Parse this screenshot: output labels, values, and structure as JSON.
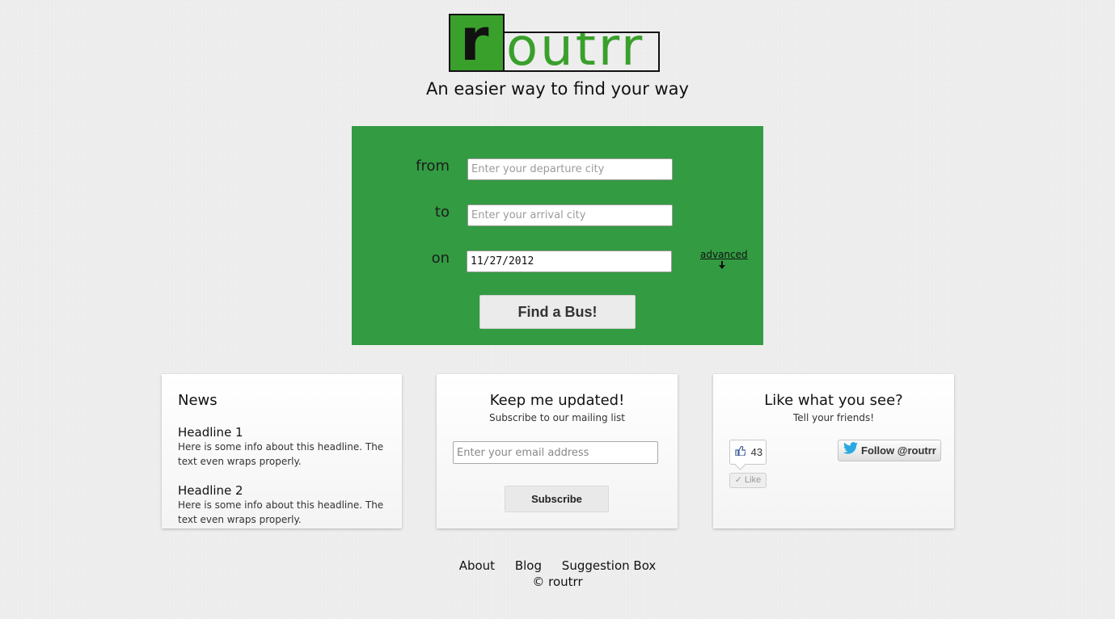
{
  "brand": {
    "logo_letter": "r",
    "logo_rest": "outrr",
    "tagline": "An easier way to find your way",
    "green": "#339b42"
  },
  "search": {
    "from_label": "from",
    "from_placeholder": "Enter your departure city",
    "to_label": "to",
    "to_placeholder": "Enter your arrival city",
    "on_label": "on",
    "date_value": "11/27/2012",
    "advanced_label": "advanced",
    "advanced_icon": "down-arrow-icon",
    "submit_label": "Find a Bus!"
  },
  "news": {
    "title": "News",
    "items": [
      {
        "headline": "Headline 1",
        "body": "Here is some info about this headline. The text even wraps properly."
      },
      {
        "headline": "Headline 2",
        "body": "Here is some info about this headline. The text even wraps properly."
      }
    ]
  },
  "mailing": {
    "title": "Keep me updated!",
    "subtitle": "Subscribe to our mailing list",
    "email_placeholder": "Enter your email address",
    "button_label": "Subscribe"
  },
  "social": {
    "title": "Like what you see?",
    "subtitle": "Tell your friends!",
    "like_count": "43",
    "like_label": "Like",
    "follow_label": "Follow @routrr"
  },
  "footer": {
    "links": [
      "About",
      "Blog",
      "Suggestion Box"
    ],
    "copyright": "© routrr"
  }
}
